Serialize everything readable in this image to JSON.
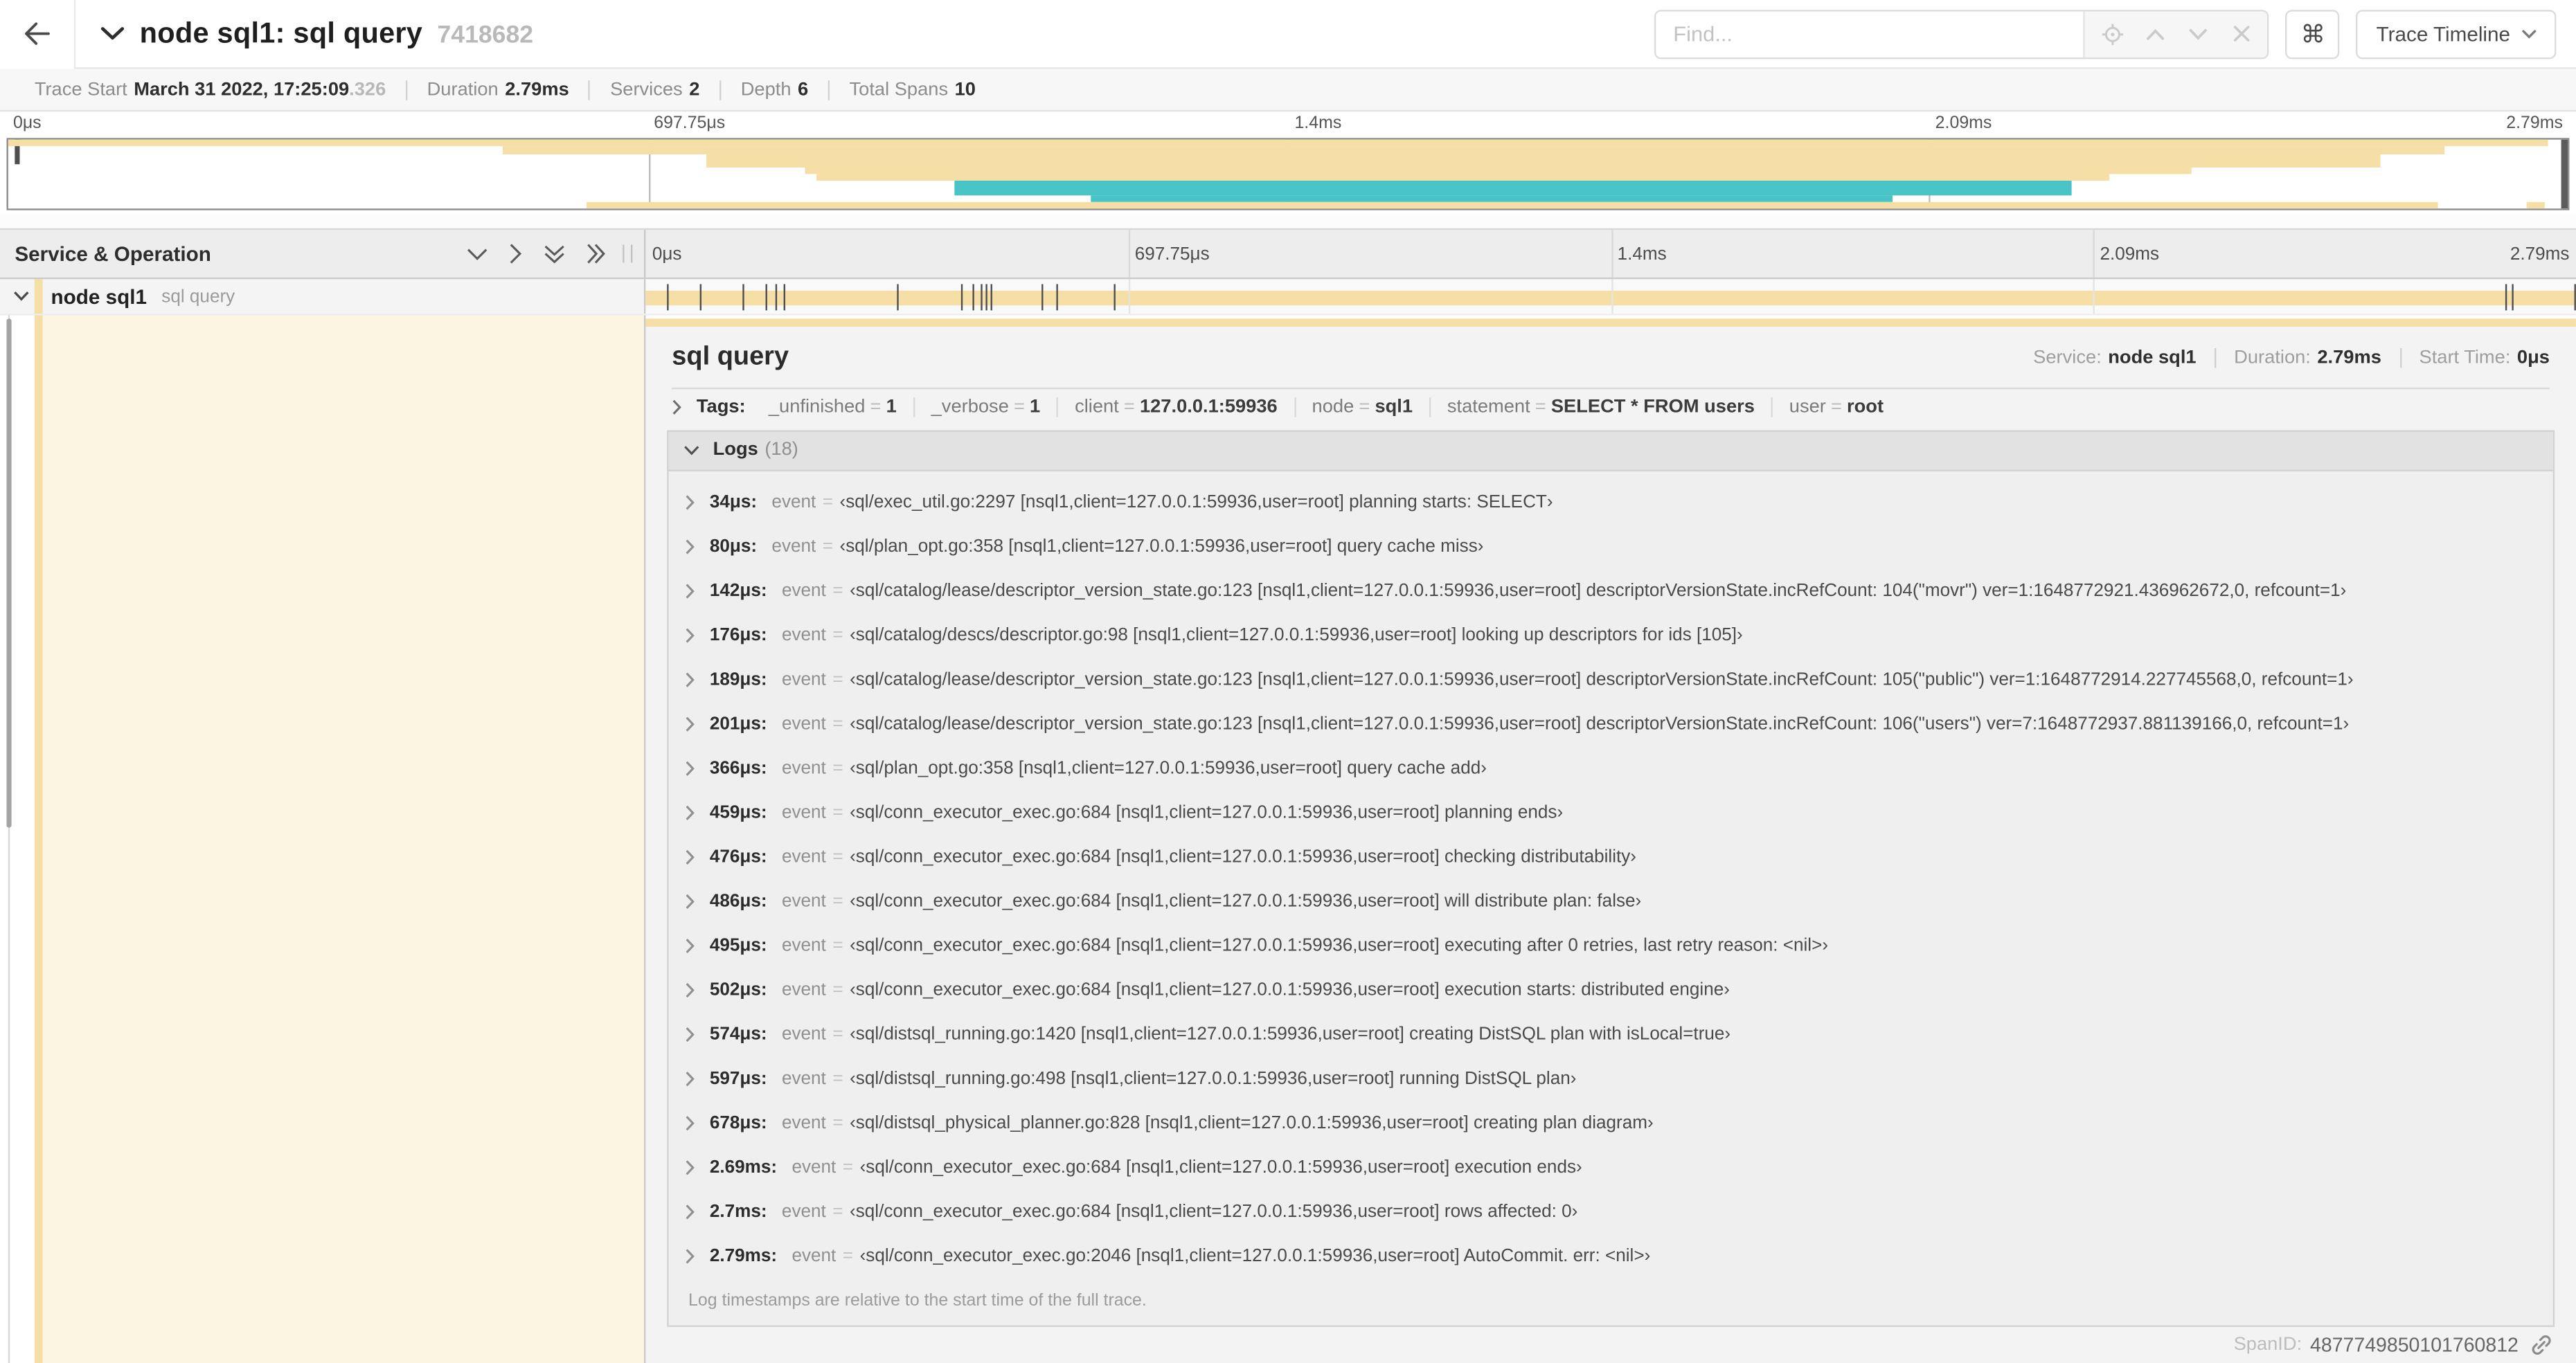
{
  "header": {
    "title": "node sql1: sql query",
    "trace_id": "7418682",
    "find_placeholder": "Find...",
    "shortcut_glyph": "⌘",
    "view_selector": "Trace Timeline"
  },
  "summary": {
    "items": [
      {
        "label": "Trace Start",
        "value": "March 31 2022, 17:25:09",
        "suffix": ".326"
      },
      {
        "label": "Duration",
        "value": "2.79ms"
      },
      {
        "label": "Services",
        "value": "2"
      },
      {
        "label": "Depth",
        "value": "6"
      },
      {
        "label": "Total Spans",
        "value": "10"
      }
    ]
  },
  "ruler": {
    "ticks": [
      "0μs",
      "697.75μs",
      "1.4ms",
      "2.09ms",
      "2.79ms"
    ],
    "positions_pct": [
      0,
      25,
      50,
      75,
      100
    ]
  },
  "minimap": {
    "colors": {
      "tan": "#f6dfa6",
      "teal": "#49c4c6"
    },
    "spans": [
      {
        "row": 0,
        "left": 0,
        "width": 99.2,
        "color": "tan"
      },
      {
        "row": 1,
        "left": 19.3,
        "width": 75.9,
        "color": "tan"
      },
      {
        "row": 2,
        "left": 27.3,
        "width": 65.4,
        "color": "tan"
      },
      {
        "row": 3,
        "left": 27.3,
        "width": 65.4,
        "color": "tan"
      },
      {
        "row": 4,
        "left": 31.1,
        "width": 54.2,
        "color": "tan"
      },
      {
        "row": 5,
        "left": 31.6,
        "width": 50.5,
        "color": "tan"
      },
      {
        "row": 6,
        "left": 37.0,
        "width": 43.6,
        "color": "teal"
      },
      {
        "row": 7,
        "left": 37.0,
        "width": 43.6,
        "color": "teal"
      },
      {
        "row": 8,
        "left": 42.3,
        "width": 31.3,
        "color": "teal"
      },
      {
        "row": 9,
        "left": 22.6,
        "width": 72.3,
        "color": "tan"
      },
      {
        "row": 9,
        "left": 98.4,
        "width": 0.7,
        "color": "tan"
      }
    ]
  },
  "tree": {
    "column_header": "Service & Operation",
    "row": {
      "service": "node sql1",
      "operation": "sql query"
    }
  },
  "span_row": {
    "bar_left_pct": 0,
    "bar_width_pct": 100,
    "bar_color": "#f6dfa6",
    "log_marker_pct": [
      1.22,
      2.87,
      5.09,
      6.31,
      6.77,
      7.2,
      13.12,
      16.45,
      17.06,
      17.42,
      17.74,
      17.99,
      20.57,
      21.4,
      24.3,
      96.42,
      96.77,
      100
    ]
  },
  "detail": {
    "title": "sql query",
    "accent_color": "#f6dfa6",
    "tint_color": "rgba(246,223,166,0.32)",
    "meta": [
      {
        "label": "Service:",
        "value": "node sql1"
      },
      {
        "label": "Duration:",
        "value": "2.79ms"
      },
      {
        "label": "Start Time:",
        "value": "0μs"
      }
    ],
    "tags_label": "Tags:",
    "eq": "=",
    "tags": [
      {
        "key": "_unfinished",
        "value": "1"
      },
      {
        "key": "_verbose",
        "value": "1"
      },
      {
        "key": "client",
        "value": "127.0.0.1:59936"
      },
      {
        "key": "node",
        "value": "sql1"
      },
      {
        "key": "statement",
        "value": "SELECT * FROM users"
      },
      {
        "key": "user",
        "value": "root"
      }
    ],
    "logs_title": "Logs",
    "logs_count": "(18)",
    "logs": [
      {
        "time": "34μs:",
        "key": "event",
        "value": "‹sql/exec_util.go:2297 [nsql1,client=127.0.0.1:59936,user=root] planning starts: SELECT›"
      },
      {
        "time": "80μs:",
        "key": "event",
        "value": "‹sql/plan_opt.go:358 [nsql1,client=127.0.0.1:59936,user=root] query cache miss›"
      },
      {
        "time": "142μs:",
        "key": "event",
        "value": "‹sql/catalog/lease/descriptor_version_state.go:123 [nsql1,client=127.0.0.1:59936,user=root] descriptorVersionState.incRefCount: 104(\"movr\") ver=1:1648772921.436962672,0, refcount=1›"
      },
      {
        "time": "176μs:",
        "key": "event",
        "value": "‹sql/catalog/descs/descriptor.go:98 [nsql1,client=127.0.0.1:59936,user=root] looking up descriptors for ids [105]›"
      },
      {
        "time": "189μs:",
        "key": "event",
        "value": "‹sql/catalog/lease/descriptor_version_state.go:123 [nsql1,client=127.0.0.1:59936,user=root] descriptorVersionState.incRefCount: 105(\"public\") ver=1:1648772914.227745568,0, refcount=1›"
      },
      {
        "time": "201μs:",
        "key": "event",
        "value": "‹sql/catalog/lease/descriptor_version_state.go:123 [nsql1,client=127.0.0.1:59936,user=root] descriptorVersionState.incRefCount: 106(\"users\") ver=7:1648772937.881139166,0, refcount=1›"
      },
      {
        "time": "366μs:",
        "key": "event",
        "value": "‹sql/plan_opt.go:358 [nsql1,client=127.0.0.1:59936,user=root] query cache add›"
      },
      {
        "time": "459μs:",
        "key": "event",
        "value": "‹sql/conn_executor_exec.go:684 [nsql1,client=127.0.0.1:59936,user=root] planning ends›"
      },
      {
        "time": "476μs:",
        "key": "event",
        "value": "‹sql/conn_executor_exec.go:684 [nsql1,client=127.0.0.1:59936,user=root] checking distributability›"
      },
      {
        "time": "486μs:",
        "key": "event",
        "value": "‹sql/conn_executor_exec.go:684 [nsql1,client=127.0.0.1:59936,user=root] will distribute plan: false›"
      },
      {
        "time": "495μs:",
        "key": "event",
        "value": "‹sql/conn_executor_exec.go:684 [nsql1,client=127.0.0.1:59936,user=root] executing after 0 retries, last retry reason: <nil>›"
      },
      {
        "time": "502μs:",
        "key": "event",
        "value": "‹sql/conn_executor_exec.go:684 [nsql1,client=127.0.0.1:59936,user=root] execution starts: distributed engine›"
      },
      {
        "time": "574μs:",
        "key": "event",
        "value": "‹sql/distsql_running.go:1420 [nsql1,client=127.0.0.1:59936,user=root] creating DistSQL plan with isLocal=true›"
      },
      {
        "time": "597μs:",
        "key": "event",
        "value": "‹sql/distsql_running.go:498 [nsql1,client=127.0.0.1:59936,user=root] running DistSQL plan›"
      },
      {
        "time": "678μs:",
        "key": "event",
        "value": "‹sql/distsql_physical_planner.go:828 [nsql1,client=127.0.0.1:59936,user=root] creating plan diagram›"
      },
      {
        "time": "2.69ms:",
        "key": "event",
        "value": "‹sql/conn_executor_exec.go:684 [nsql1,client=127.0.0.1:59936,user=root] execution ends›"
      },
      {
        "time": "2.7ms:",
        "key": "event",
        "value": "‹sql/conn_executor_exec.go:684 [nsql1,client=127.0.0.1:59936,user=root] rows affected: 0›"
      },
      {
        "time": "2.79ms:",
        "key": "event",
        "value": "‹sql/conn_executor_exec.go:2046 [nsql1,client=127.0.0.1:59936,user=root] AutoCommit. err: <nil>›"
      }
    ],
    "logs_note": "Log timestamps are relative to the start time of the full trace.",
    "footer": {
      "label": "SpanID:",
      "value": "4877749850101760812"
    }
  }
}
